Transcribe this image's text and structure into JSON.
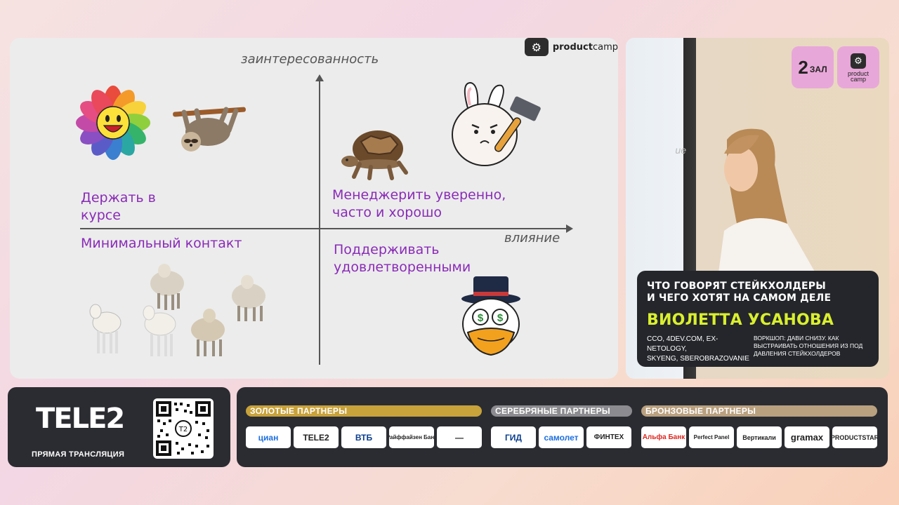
{
  "slide": {
    "brand": {
      "prefix": "product",
      "suffix": "camp"
    },
    "axis_y_label": "заинтересованность",
    "axis_x_label": "влияние",
    "quadrants": {
      "top_left": [
        "Держать в",
        "курсе"
      ],
      "top_right": [
        "Менеджерить уверенно,",
        "часто и хорошо"
      ],
      "bottom_left": [
        "Минимальный контакт"
      ],
      "bottom_right": [
        "Поддерживать",
        "удовлетворенными"
      ]
    }
  },
  "video": {
    "screen_ghost_text": "ие",
    "hall": {
      "number": "2",
      "word": "ЗАЛ"
    },
    "hall_logo": {
      "line1": "product",
      "line2": "camp"
    },
    "talk_title_line1": "ЧТО ГОВОРЯТ СТЕЙКХОЛДЕРЫ",
    "talk_title_line2": "И ЧЕГО ХОТЯТ НА САМОМ ДЕЛЕ",
    "speaker_name": "ВИОЛЕТТА УСАНОВА",
    "speaker_role_line1": "CCO, 4DEV.COM, EX-NETOLOGY,",
    "speaker_role_line2": "SKYENG, SBEROBRAZOVANIE",
    "workshop_line1": "ВОРКШОП: ДАВИ СНИЗУ. КАК",
    "workshop_line2": "ВЫСТРАИВАТЬ ОТНОШЕНИЯ ИЗ ПОД",
    "workshop_line3": "ДАВЛЕНИЯ СТЕЙКХОЛДЕРОВ",
    "name_color": "#d9ef2e"
  },
  "sponsor": {
    "logo": "TELE2",
    "live_label": "ПРЯМАЯ ТРАНСЛЯЦИЯ",
    "qr_center": "T2"
  },
  "partners": {
    "gold": {
      "label": "ЗОЛОТЫЕ ПАРТНЕРЫ",
      "color": "#c8a23a",
      "logos": [
        "циан",
        "TELE2",
        "ВТБ",
        "Райффайзен Банк",
        "—"
      ]
    },
    "silver": {
      "label": "СЕРЕБРЯНЫЕ ПАРТНЕРЫ",
      "color": "#8c8c90",
      "logos": [
        "ГИД",
        "самолет",
        "ФИНТЕХ"
      ]
    },
    "bronze": {
      "label": "БРОНЗОВЫЕ ПАРТНЕРЫ",
      "color": "#b9a07f",
      "logos": [
        "Альфа Банк",
        "Perfect Panel",
        "Вертикали",
        "gramax",
        "PRODUCTSTAR"
      ]
    }
  }
}
